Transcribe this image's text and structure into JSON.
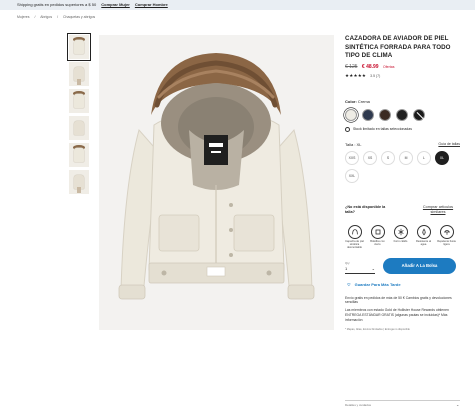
{
  "promo": {
    "text": "Shipping gratis en pedidos superiores a $ 50",
    "link1": "Comprar Mujer",
    "link2": "Comprar Hombre"
  },
  "breadcrumb": [
    "Mujeres",
    "Abrigos",
    "Chaquetas y abrigos"
  ],
  "product": {
    "title": "CAZADORA DE AVIADOR DE PIEL SINTÉTICA FORRADA PARA TODO TIPO DE CLIMA",
    "old_price": "€ 125",
    "new_price": "€ 48.99",
    "sale_label": "Ofertas",
    "stars": "★★★★★",
    "rating": "3.5 (7)"
  },
  "color": {
    "label": "Color:",
    "value": "Crema",
    "swatches": [
      "#efede6",
      "#2f3a4f",
      "#3b2a22",
      "#1f1f1f",
      "#1a1a1a"
    ]
  },
  "stock_note": "Stock limitado en tallas seleccionadas",
  "size": {
    "label": "Talla : XL",
    "guide": "Guía de tallas",
    "options": [
      "XXS",
      "XS",
      "S",
      "M",
      "L",
      "XL",
      "XXL"
    ],
    "selected": "XL"
  },
  "help": {
    "question": "¿No está disponible la talla?",
    "link": "Comprar artículos similares"
  },
  "features": [
    "Capucha de piel sintética desmontable",
    "Bolsillos con cierre",
    "Forro cálido",
    "Resistente al agua",
    "Repelente lluvia ligera"
  ],
  "quantity": {
    "label": "Qty:",
    "value": "1"
  },
  "add_button": "Añadir A La Bolsa",
  "save_label": "Guardar Para Más Tarde",
  "shipping": [
    "Envío gratis en pedidos de más de 50 € Cambios gratis y devoluciones sencillas",
    "Las miembros con estado Gold de Hollister House Rewards obtienen ENTREGA ESTÁNDAR GRATIS (algunas pautas se incluidas)* Más información"
  ],
  "footnote": "* Mapas, Altas, Envíos Ilimitados | Entrega no disponible",
  "bottom_label": "Detalles y cuidados"
}
